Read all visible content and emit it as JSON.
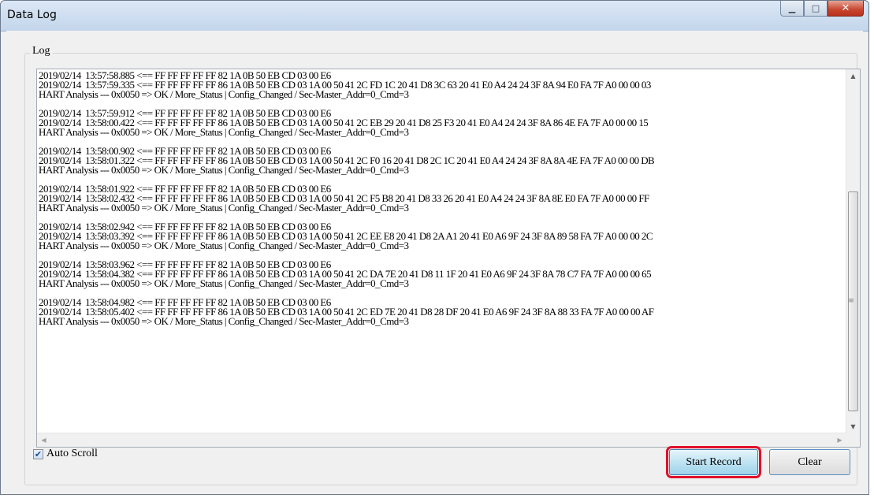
{
  "window": {
    "title": "Data Log",
    "minimize_glyph": "▁",
    "maximize_glyph": "□",
    "close_glyph": "✕"
  },
  "log_group": {
    "label": "Log",
    "lines": [
      "2019/02/14  13:57:58.885 <== FF FF FF FF FF 82 1A 0B 50 EB CD 03 00 E6",
      "2019/02/14  13:57:59.335 <== FF FF FF FF FF 86 1A 0B 50 EB CD 03 1A 00 50 41 2C FD 1C 20 41 D8 3C 63 20 41 E0 A4 24 24 3F 8A 94 E0 FA 7F A0 00 00 03",
      "HART Analysis --- 0x0050 => OK / More_Status | Config_Changed / Sec-Master_Addr=0_Cmd=3",
      "",
      "2019/02/14  13:57:59.912 <== FF FF FF FF FF 82 1A 0B 50 EB CD 03 00 E6",
      "2019/02/14  13:58:00.422 <== FF FF FF FF FF 86 1A 0B 50 EB CD 03 1A 00 50 41 2C EB 29 20 41 D8 25 F3 20 41 E0 A4 24 24 3F 8A 86 4E FA 7F A0 00 00 15",
      "HART Analysis --- 0x0050 => OK / More_Status | Config_Changed / Sec-Master_Addr=0_Cmd=3",
      "",
      "2019/02/14  13:58:00.902 <== FF FF FF FF FF 82 1A 0B 50 EB CD 03 00 E6",
      "2019/02/14  13:58:01.322 <== FF FF FF FF FF 86 1A 0B 50 EB CD 03 1A 00 50 41 2C F0 16 20 41 D8 2C 1C 20 41 E0 A4 24 24 3F 8A 8A 4E FA 7F A0 00 00 DB",
      "HART Analysis --- 0x0050 => OK / More_Status | Config_Changed / Sec-Master_Addr=0_Cmd=3",
      "",
      "2019/02/14  13:58:01.922 <== FF FF FF FF FF 82 1A 0B 50 EB CD 03 00 E6",
      "2019/02/14  13:58:02.432 <== FF FF FF FF FF 86 1A 0B 50 EB CD 03 1A 00 50 41 2C F5 B8 20 41 D8 33 26 20 41 E0 A4 24 24 3F 8A 8E E0 FA 7F A0 00 00 FF",
      "HART Analysis --- 0x0050 => OK / More_Status | Config_Changed / Sec-Master_Addr=0_Cmd=3",
      "",
      "2019/02/14  13:58:02.942 <== FF FF FF FF FF 82 1A 0B 50 EB CD 03 00 E6",
      "2019/02/14  13:58:03.392 <== FF FF FF FF FF 86 1A 0B 50 EB CD 03 1A 00 50 41 2C EE E8 20 41 D8 2A A1 20 41 E0 A6 9F 24 3F 8A 89 58 FA 7F A0 00 00 2C",
      "HART Analysis --- 0x0050 => OK / More_Status | Config_Changed / Sec-Master_Addr=0_Cmd=3",
      "",
      "2019/02/14  13:58:03.962 <== FF FF FF FF FF 82 1A 0B 50 EB CD 03 00 E6",
      "2019/02/14  13:58:04.382 <== FF FF FF FF FF 86 1A 0B 50 EB CD 03 1A 00 50 41 2C DA 7E 20 41 D8 11 1F 20 41 E0 A6 9F 24 3F 8A 78 C7 FA 7F A0 00 00 65",
      "HART Analysis --- 0x0050 => OK / More_Status | Config_Changed / Sec-Master_Addr=0_Cmd=3",
      "",
      "2019/02/14  13:58:04.982 <== FF FF FF FF FF 82 1A 0B 50 EB CD 03 00 E6",
      "2019/02/14  13:58:05.402 <== FF FF FF FF FF 86 1A 0B 50 EB CD 03 1A 00 50 41 2C ED 7E 20 41 D8 28 DF 20 41 E0 A6 9F 24 3F 8A 88 33 FA 7F A0 00 00 AF",
      "HART Analysis --- 0x0050 => OK / More_Status | Config_Changed / Sec-Master_Addr=0_Cmd=3"
    ]
  },
  "auto_scroll": {
    "label": "Auto Scroll",
    "checked": true
  },
  "buttons": {
    "start_record": "Start Record",
    "clear": "Clear"
  },
  "colors": {
    "highlight": "#e0102b"
  }
}
